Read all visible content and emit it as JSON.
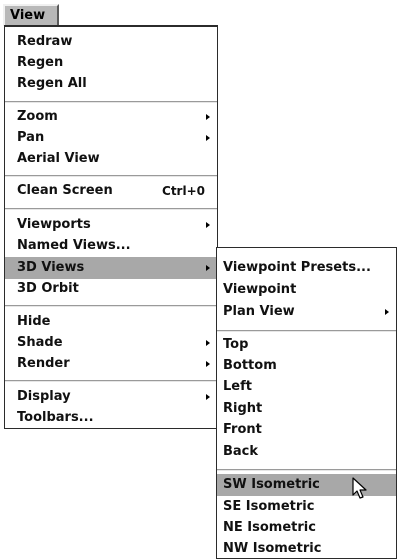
{
  "menubar": {
    "view_label": "View"
  },
  "view_menu": {
    "items": [
      {
        "label": "Redraw"
      },
      {
        "label": "Regen"
      },
      {
        "label": "Regen All"
      },
      {
        "label": "Zoom"
      },
      {
        "label": "Pan"
      },
      {
        "label": "Aerial View"
      },
      {
        "label": "Clean Screen",
        "shortcut": "Ctrl+0"
      },
      {
        "label": "Viewports"
      },
      {
        "label": "Named Views..."
      },
      {
        "label": "3D Views"
      },
      {
        "label": "3D Orbit"
      },
      {
        "label": "Hide"
      },
      {
        "label": "Shade"
      },
      {
        "label": "Render"
      },
      {
        "label": "Display"
      },
      {
        "label": "Toolbars..."
      }
    ]
  },
  "views_submenu": {
    "items": [
      {
        "label": "Viewpoint Presets..."
      },
      {
        "label": "Viewpoint"
      },
      {
        "label": "Plan View"
      },
      {
        "label": "Top"
      },
      {
        "label": "Bottom"
      },
      {
        "label": "Left"
      },
      {
        "label": "Right"
      },
      {
        "label": "Front"
      },
      {
        "label": "Back"
      },
      {
        "label": "SW Isometric"
      },
      {
        "label": "SE Isometric"
      },
      {
        "label": "NE Isometric"
      },
      {
        "label": "NW Isometric"
      }
    ]
  },
  "colors": {
    "highlight": "#a8a8a8",
    "menu_background": "#ffffff",
    "menubar_active": "#b8b8b8"
  }
}
